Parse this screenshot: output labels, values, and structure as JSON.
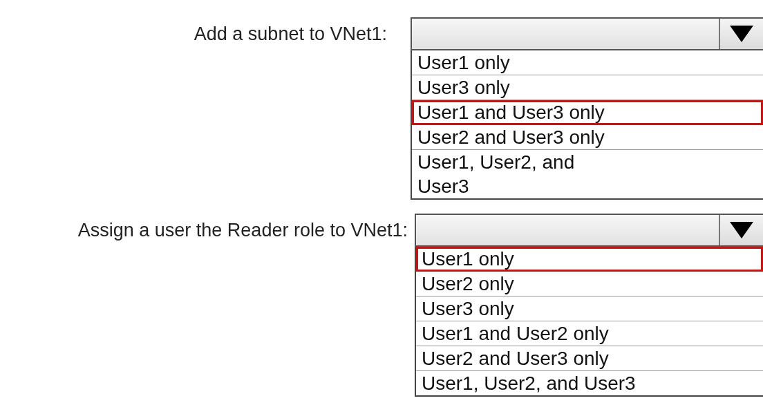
{
  "questions": [
    {
      "label": "Add a subnet to VNet1:",
      "options": [
        {
          "text": "User1 only",
          "selected": false
        },
        {
          "text": "User3 only",
          "selected": false
        },
        {
          "text": "User1 and User3 only",
          "selected": true
        },
        {
          "text": "User2 and User3 only",
          "selected": false
        },
        {
          "text": "User1, User2, and User3",
          "selected": false
        }
      ]
    },
    {
      "label": "Assign a user the Reader role to VNet1:",
      "options": [
        {
          "text": "User1 only",
          "selected": true
        },
        {
          "text": "User2 only",
          "selected": false
        },
        {
          "text": "User3 only",
          "selected": false
        },
        {
          "text": "User1 and User2 only",
          "selected": false
        },
        {
          "text": "User2 and User3 only",
          "selected": false
        },
        {
          "text": "User1, User2, and User3",
          "selected": false
        }
      ]
    }
  ]
}
